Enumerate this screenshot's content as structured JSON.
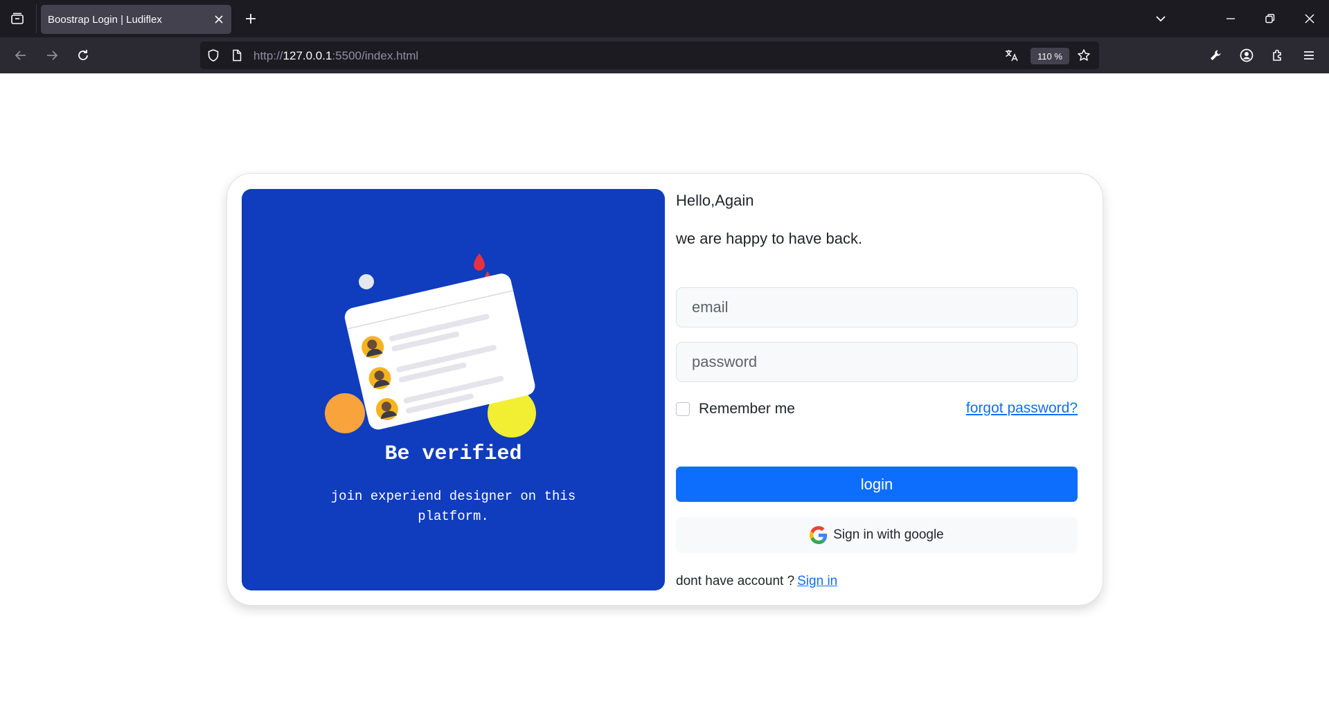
{
  "browser": {
    "tab_title": "Boostrap Login | Ludiflex",
    "url_prefix": "http://",
    "url_host": "127.0.0.1",
    "url_path": ":5500/index.html",
    "zoom": "110 %"
  },
  "featured": {
    "title": "Be verified",
    "text": "join experiend designer on this platform."
  },
  "form": {
    "greeting": "Hello,Again",
    "subtitle": "we are happy to have back.",
    "email_placeholder": "email",
    "password_placeholder": "password",
    "remember_label": "Remember me",
    "forgot_link": "forgot password?",
    "login_button": "login",
    "google_button": "Sign in with google",
    "signup_text": "dont have account ?",
    "signup_link": "Sign in"
  },
  "colors": {
    "primary": "#0d6efd",
    "featured_bg": "#103cbe",
    "chrome_dark": "#1c1b22",
    "chrome_nav": "#2b2a33"
  },
  "icons": [
    "tab-list-icon",
    "close-icon",
    "plus-icon",
    "chevron-down-icon",
    "minimize-icon",
    "restore-icon",
    "back-icon",
    "forward-icon",
    "reload-icon",
    "shield-icon",
    "page-icon",
    "translate-icon",
    "star-icon",
    "wrench-icon",
    "account-icon",
    "extensions-icon",
    "menu-icon",
    "google-icon"
  ]
}
